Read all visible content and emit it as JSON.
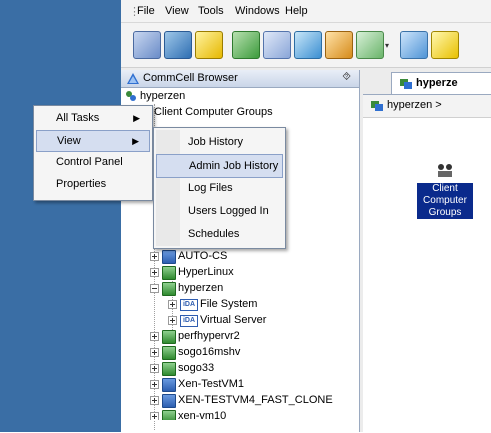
{
  "menubar": {
    "items": [
      "File",
      "View",
      "Tools",
      "Windows",
      "Help"
    ]
  },
  "toolbar": {
    "buttons": [
      "new-icon",
      "console-icon",
      "help-icon",
      "clients-icon",
      "calendar-icon",
      "storage-icon",
      "reports-icon",
      "policies-icon",
      "alerts-icon",
      "export-icon"
    ]
  },
  "browser_panel": {
    "title": "CommCell Browser",
    "pin_glyph": "⯑",
    "tree": [
      {
        "label": "hyperzen"
      },
      {
        "label": "Client Computer Groups"
      },
      {
        "label": "AUTO-CS"
      },
      {
        "label": "HyperLinux"
      },
      {
        "label": "hyperzen"
      },
      {
        "label": "File System"
      },
      {
        "label": "Virtual Server"
      },
      {
        "label": "perfhypervr2"
      },
      {
        "label": "sogo16mshv"
      },
      {
        "label": "sogo33"
      },
      {
        "label": "Xen-TestVM1"
      },
      {
        "label": "XEN-TESTVM4_FAST_CLONE"
      },
      {
        "label": "xen-vm10"
      }
    ]
  },
  "tab": {
    "label": "hyperze"
  },
  "breadcrumb": {
    "label": "hyperzen >"
  },
  "tile": {
    "label_lines": [
      "Client",
      "Computer",
      "Groups"
    ]
  },
  "context_menu": {
    "items": [
      {
        "label": "All Tasks",
        "submenu": "▶"
      },
      {
        "label": "View",
        "submenu": "▶"
      },
      {
        "label": "Control Panel",
        "submenu": ""
      },
      {
        "label": "Properties",
        "submenu": ""
      }
    ]
  },
  "view_submenu": {
    "items": [
      "Job History",
      "Admin Job History",
      "Log Files",
      "Users Logged In",
      "Schedules"
    ]
  }
}
